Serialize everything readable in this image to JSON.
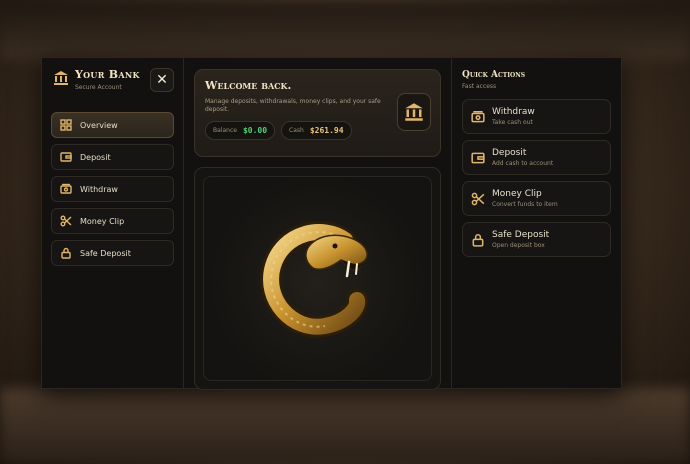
{
  "sidebar": {
    "title": "Your Bank",
    "subtitle": "Secure Account",
    "close_label": "✕",
    "items": [
      {
        "label": "Overview",
        "icon": "grid-icon",
        "active": true
      },
      {
        "label": "Deposit",
        "icon": "wallet-icon"
      },
      {
        "label": "Withdraw",
        "icon": "cash-icon"
      },
      {
        "label": "Money Clip",
        "icon": "scissors-icon"
      },
      {
        "label": "Safe Deposit",
        "icon": "lock-icon"
      }
    ]
  },
  "welcome": {
    "title": "Welcome back.",
    "description": "Manage deposits, withdrawals, money clips, and your safe deposit.",
    "balance_label": "Balance",
    "balance_value": "$0.00",
    "cash_label": "Cash",
    "cash_value": "$261.94"
  },
  "quick_actions": {
    "title": "Quick Actions",
    "subtitle": "Fast access",
    "items": [
      {
        "label": "Withdraw",
        "desc": "Take cash out",
        "icon": "cash-icon"
      },
      {
        "label": "Deposit",
        "desc": "Add cash to account",
        "icon": "wallet-icon"
      },
      {
        "label": "Money Clip",
        "desc": "Convert funds to item",
        "icon": "scissors-icon"
      },
      {
        "label": "Safe Deposit",
        "desc": "Open deposit box",
        "icon": "lock-icon"
      }
    ]
  },
  "colors": {
    "accent": "#e0b56a",
    "balance": "#4fd17a",
    "cash": "#e9c37b"
  }
}
